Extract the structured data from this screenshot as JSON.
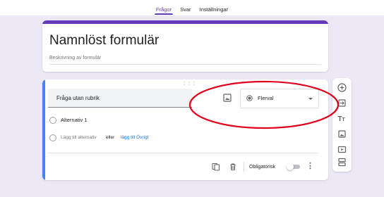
{
  "tabs": [
    {
      "label": "Frågor",
      "active": true
    },
    {
      "label": "Svar"
    },
    {
      "label": "Inställningar"
    }
  ],
  "form": {
    "title": "Namnlöst formulär",
    "description": "Beskrivning av formulär"
  },
  "question": {
    "title": "Fråga utan rubrik",
    "type": "Flerval",
    "option1": "Alternativ 1",
    "add_option": "Lägg till alternativ",
    "or_text": "eller",
    "add_other": "lägg till Övrigt",
    "required_label": "Obligatorisk",
    "required": false
  },
  "side_toolbar": [
    "add-question-icon",
    "import-questions-icon",
    "title-text-icon",
    "image-icon",
    "video-icon",
    "section-icon"
  ],
  "colors": {
    "accent": "#673ab7",
    "active_bar": "#4285f4",
    "annotation": "#e0001b",
    "link": "#1a73e8"
  }
}
